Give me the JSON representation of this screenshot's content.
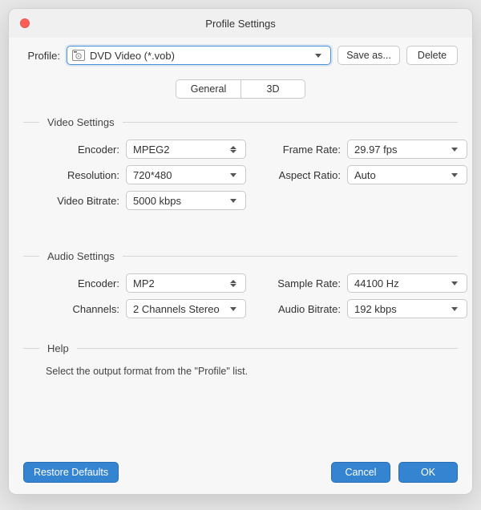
{
  "title": "Profile Settings",
  "profile": {
    "label": "Profile:",
    "value": "DVD Video (*.vob)",
    "save_label": "Save as...",
    "delete_label": "Delete"
  },
  "tabs": {
    "general": "General",
    "three_d": "3D"
  },
  "video": {
    "legend": "Video Settings",
    "encoder_label": "Encoder:",
    "encoder_value": "MPEG2",
    "resolution_label": "Resolution:",
    "resolution_value": "720*480",
    "bitrate_label": "Video Bitrate:",
    "bitrate_value": "5000 kbps",
    "framerate_label": "Frame Rate:",
    "framerate_value": "29.97 fps",
    "aspect_label": "Aspect Ratio:",
    "aspect_value": "Auto"
  },
  "audio": {
    "legend": "Audio Settings",
    "encoder_label": "Encoder:",
    "encoder_value": "MP2",
    "channels_label": "Channels:",
    "channels_value": "2 Channels Stereo",
    "samplerate_label": "Sample Rate:",
    "samplerate_value": "44100 Hz",
    "bitrate_label": "Audio Bitrate:",
    "bitrate_value": "192 kbps"
  },
  "help": {
    "legend": "Help",
    "text": "Select the output format from the \"Profile\" list."
  },
  "footer": {
    "restore": "Restore Defaults",
    "cancel": "Cancel",
    "ok": "OK"
  }
}
